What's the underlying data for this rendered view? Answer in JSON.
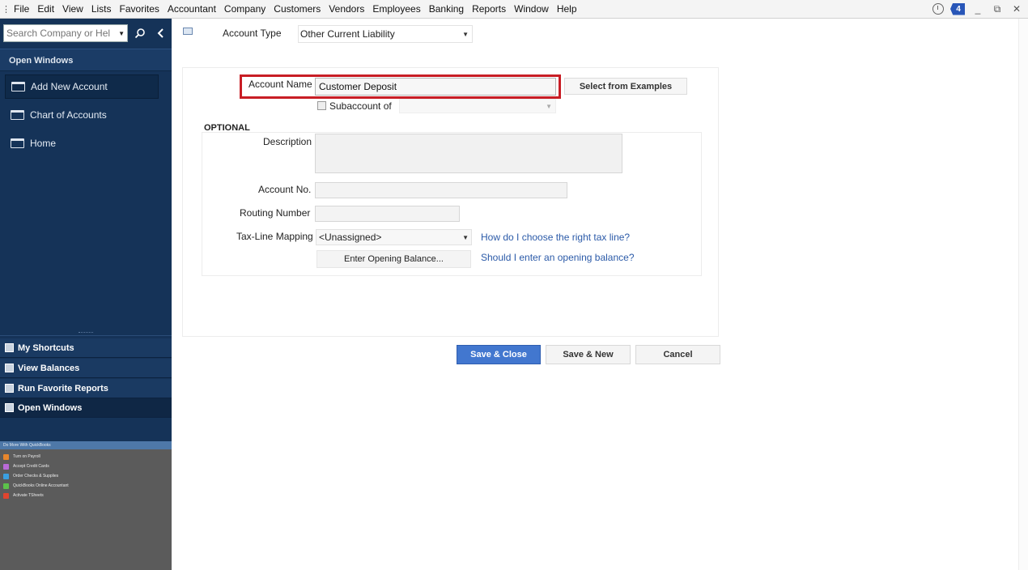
{
  "menu": {
    "items": [
      "File",
      "Edit",
      "View",
      "Lists",
      "Favorites",
      "Accountant",
      "Company",
      "Customers",
      "Vendors",
      "Employees",
      "Banking",
      "Reports",
      "Window",
      "Help"
    ],
    "alert_count": "4",
    "minimize": "_",
    "restore": "⧉",
    "close": "✕"
  },
  "sidebar": {
    "search_placeholder": "Search Company or Help",
    "open_windows_title": "Open Windows",
    "open_windows": [
      {
        "label": "Add New Account"
      },
      {
        "label": "Chart of Accounts"
      },
      {
        "label": "Home"
      }
    ],
    "shortcuts": [
      {
        "label": "My Shortcuts"
      },
      {
        "label": "View Balances"
      },
      {
        "label": "Run Favorite Reports"
      },
      {
        "label": "Open Windows"
      }
    ],
    "promo": {
      "title": "Do More With QuickBooks",
      "items": [
        {
          "label": "Turn on Payroll",
          "color": "#e8862c"
        },
        {
          "label": "Accept Credit Cards",
          "color": "#b96ad8"
        },
        {
          "label": "Order Checks & Supplies",
          "color": "#3aa0e0"
        },
        {
          "label": "QuickBooks Online Accountant",
          "color": "#5cc24a"
        },
        {
          "label": "Activate TSheets",
          "color": "#e0442e"
        }
      ]
    }
  },
  "form": {
    "account_type_label": "Account Type",
    "account_type_value": "Other Current Liability",
    "account_name_label": "Account Name",
    "account_name_value": "Customer Deposit",
    "select_examples": "Select from Examples",
    "subaccount_label": "Subaccount of",
    "optional_label": "OPTIONAL",
    "description_label": "Description",
    "account_no_label": "Account No.",
    "routing_label": "Routing Number",
    "taxline_label": "Tax-Line Mapping",
    "taxline_value": "<Unassigned>",
    "taxline_help": "How do I choose the right tax line?",
    "opening_balance_btn": "Enter Opening Balance...",
    "opening_help": "Should I enter an opening balance?"
  },
  "buttons": {
    "save_close": "Save & Close",
    "save_new": "Save & New",
    "cancel": "Cancel"
  },
  "colors": {
    "sidebar_bg": "#153358",
    "highlight": "#c81d25",
    "primary_button": "#4277cf",
    "link": "#2b5aa8"
  }
}
